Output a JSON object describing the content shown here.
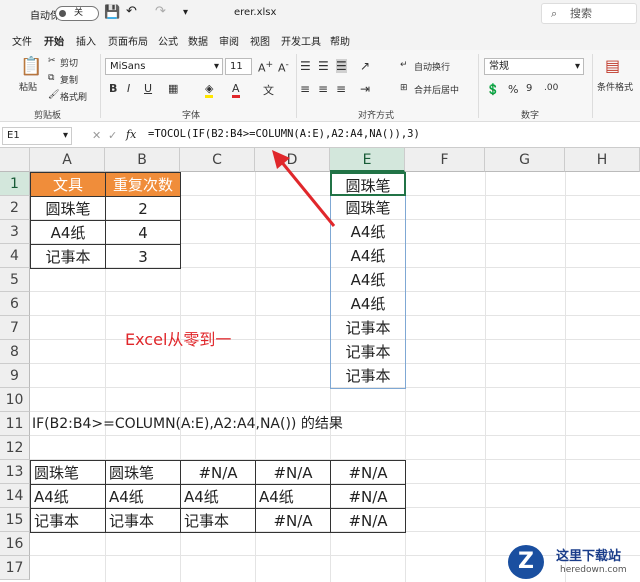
{
  "titlebar": {
    "autosave_label": "自动保存",
    "autosave_state": "关",
    "filename": "erer.xlsx",
    "search_placeholder": "搜索"
  },
  "menu": [
    "文件",
    "开始",
    "插入",
    "页面布局",
    "公式",
    "数据",
    "审阅",
    "视图",
    "开发工具",
    "帮助"
  ],
  "ribbon": {
    "paste": "粘贴",
    "cut": "剪切",
    "copy": "复制",
    "format_painter": "格式刷",
    "clipboard": "剪贴板",
    "font_name": "MiSans",
    "font_size": "11",
    "font_group": "字体",
    "wrap": "自动换行",
    "merge": "合并后居中",
    "align_group": "对齐方式",
    "number_format": "常规",
    "number_group": "数字",
    "cond_format": "条件格式",
    "bold": "B",
    "italic": "I",
    "underline": "U"
  },
  "formula_bar": {
    "name_box": "E1",
    "fx": "fx",
    "formula": "=TOCOL(IF(B2:B4>=COLUMN(A:E),A2:A4,NA()),3)"
  },
  "columns": [
    "A",
    "B",
    "C",
    "D",
    "E",
    "F",
    "G",
    "H"
  ],
  "rows": [
    "1",
    "2",
    "3",
    "4",
    "5",
    "6",
    "7",
    "8",
    "9",
    "10",
    "11",
    "12",
    "13",
    "14",
    "15",
    "16",
    "17"
  ],
  "table1": {
    "header": [
      "文具",
      "重复次数"
    ],
    "rows": [
      [
        "圆珠笔",
        "2"
      ],
      [
        "A4纸",
        "4"
      ],
      [
        "记事本",
        "3"
      ]
    ]
  },
  "result_col": [
    "圆珠笔",
    "圆珠笔",
    "A4纸",
    "A4纸",
    "A4纸",
    "A4纸",
    "记事本",
    "记事本",
    "记事本"
  ],
  "annotation": "Excel从零到一",
  "row11_text": "IF(B2:B4>=COLUMN(A:E),A2:A4,NA())   的结果",
  "table2": [
    [
      "圆珠笔",
      "圆珠笔",
      "#N/A",
      "#N/A",
      "#N/A"
    ],
    [
      "A4纸",
      "A4纸",
      "A4纸",
      "A4纸",
      "#N/A"
    ],
    [
      "记事本",
      "记事本",
      "记事本",
      "#N/A",
      "#N/A"
    ]
  ],
  "watermark": {
    "site": "这里下载站",
    "url": "heredown.com"
  },
  "colors": {
    "header_orange": "#f08d3a",
    "excel_green": "#217346",
    "annotation_red": "#e0272b"
  }
}
